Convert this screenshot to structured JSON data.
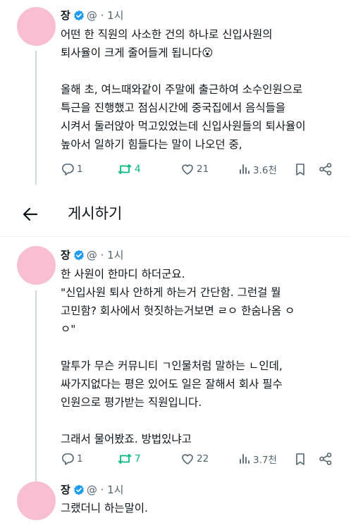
{
  "author": {
    "name": "장",
    "handle": "@",
    "time": "1시"
  },
  "posts": [
    {
      "text": "어떤 한 직원의 사소한 건의 하나로 신입사원의\n퇴사율이 크게 줄어들게 됩니다😮\n\n올해 초, 여느때와같이 주말에 출근하여 소수인원으로\n특근을 진행했고 점심시간에 중국집에서 음식들을\n시켜서 둘러앉아 먹고있었는데 신입사원들의 퇴사율이\n높아서 일하기 힘들다는 말이 나오던 중,",
      "replies": "1",
      "reposts": "4",
      "likes": "21",
      "views": "3.6천"
    },
    {
      "text": "한 사원이 한마디 하더군요.\n\"신입사원 퇴사 안하게 하는거 간단함. 그런걸 뭘\n고민함? 회사에서 헛짓하는거보면 ㄹㅇ 한숨나옴 ㅇ\nㅇ\"\n\n말투가 무슨 커뮤니티 ㄱ인물처럼 말하는 ㄴ인데,\n싸가지없다는 평은 있어도 일은 잘해서 회사 필수\n인원으로 평가받는 직원입니다.\n\n그래서 물어봤죠. 방법있냐고",
      "replies": "1",
      "reposts": "7",
      "likes": "22",
      "views": "3.7천"
    },
    {
      "text": "그랬더니 하는말이."
    }
  ],
  "topbar": {
    "title": "게시하기"
  },
  "colors": {
    "avatar": "#f8bfd2",
    "verified": "#1d9bf0",
    "repost": "#00ba7c",
    "muted": "#536471"
  },
  "icons": [
    "back-arrow-icon",
    "verified-badge-icon",
    "reply-icon",
    "repost-icon",
    "like-icon",
    "views-icon",
    "bookmark-icon",
    "share-icon"
  ]
}
